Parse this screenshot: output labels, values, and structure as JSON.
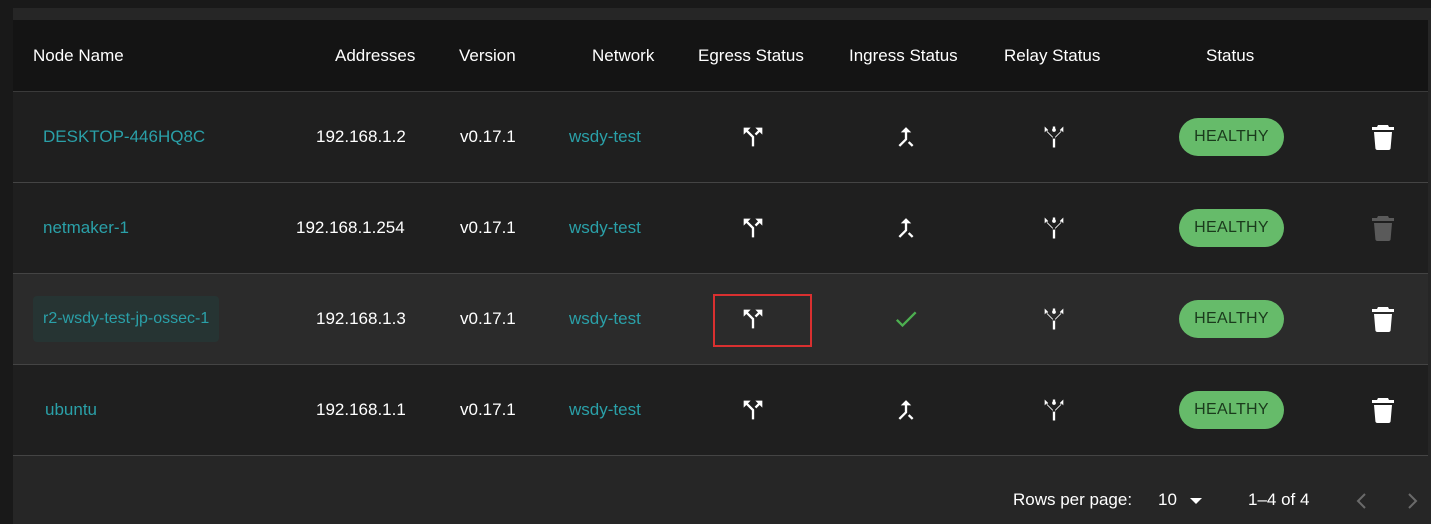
{
  "table": {
    "headers": {
      "node_name": "Node Name",
      "addresses": "Addresses",
      "version": "Version",
      "network": "Network",
      "egress_status": "Egress Status",
      "ingress_status": "Ingress Status",
      "relay_status": "Relay Status",
      "status": "Status"
    },
    "rows": [
      {
        "name": "DESKTOP-446HQ8C",
        "address": "192.168.1.2",
        "version": "v0.17.1",
        "network": "wsdy-test",
        "egress_icon": "egress-fork-icon",
        "ingress_icon": "ingress-merge-icon",
        "relay_icon": "relay-branch-icon",
        "status": "HEALTHY",
        "delete_icon": "trash-icon"
      },
      {
        "name": "netmaker-1",
        "address": "192.168.1.254",
        "version": "v0.17.1",
        "network": "wsdy-test",
        "egress_icon": "egress-fork-icon",
        "ingress_icon": "ingress-merge-icon",
        "relay_icon": "relay-branch-icon",
        "status": "HEALTHY",
        "delete_icon": "trash-icon-disabled"
      },
      {
        "name": "r2-wsdy-test-jp-ossec-1",
        "address": "192.168.1.3",
        "version": "v0.17.1",
        "network": "wsdy-test",
        "egress_icon": "egress-fork-icon",
        "ingress_icon": "check-icon",
        "relay_icon": "relay-branch-icon",
        "status": "HEALTHY",
        "delete_icon": "trash-icon"
      },
      {
        "name": "ubuntu",
        "address": "192.168.1.1",
        "version": "v0.17.1",
        "network": "wsdy-test",
        "egress_icon": "egress-fork-icon",
        "ingress_icon": "ingress-merge-icon",
        "relay_icon": "relay-branch-icon",
        "status": "HEALTHY",
        "delete_icon": "trash-icon"
      }
    ]
  },
  "pagination": {
    "rows_per_page_label": "Rows per page:",
    "rows_per_page_value": "10",
    "range_text": "1–4 of 4"
  },
  "colors": {
    "link": "#2aa0a8",
    "healthy_badge": "#66bb6a",
    "check": "#4caf50",
    "highlight": "#d93030"
  }
}
